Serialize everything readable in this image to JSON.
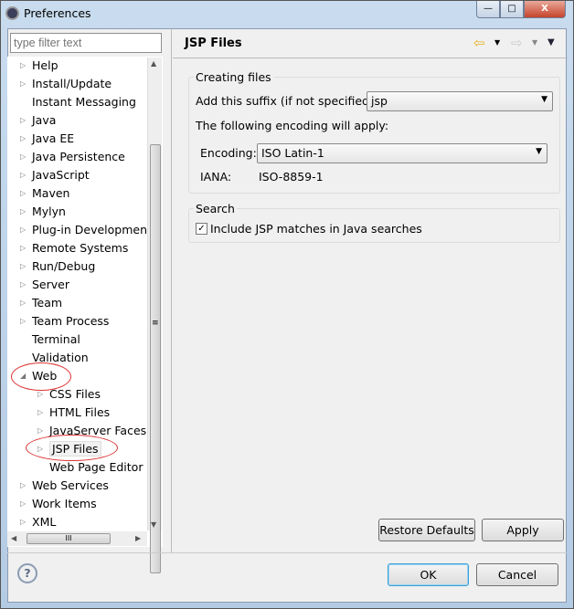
{
  "window": {
    "title": "Preferences",
    "minimize": "—",
    "maximize": "□",
    "close": "X"
  },
  "sidebar": {
    "filter_placeholder": "type filter text",
    "scroll_h_grip": "III",
    "scroll_v_grip": "≡",
    "items": [
      {
        "label": "Help",
        "expandable": true
      },
      {
        "label": "Install/Update",
        "expandable": true
      },
      {
        "label": "Instant Messaging",
        "expandable": false
      },
      {
        "label": "Java",
        "expandable": true
      },
      {
        "label": "Java EE",
        "expandable": true
      },
      {
        "label": "Java Persistence",
        "expandable": true
      },
      {
        "label": "JavaScript",
        "expandable": true
      },
      {
        "label": "Maven",
        "expandable": true
      },
      {
        "label": "Mylyn",
        "expandable": true
      },
      {
        "label": "Plug-in Development",
        "expandable": true
      },
      {
        "label": "Remote Systems",
        "expandable": true
      },
      {
        "label": "Run/Debug",
        "expandable": true
      },
      {
        "label": "Server",
        "expandable": true
      },
      {
        "label": "Team",
        "expandable": true
      },
      {
        "label": "Team Process",
        "expandable": true
      },
      {
        "label": "Terminal",
        "expandable": false
      },
      {
        "label": "Validation",
        "expandable": false
      },
      {
        "label": "Web",
        "expandable": true,
        "expanded": true
      },
      {
        "label": "CSS Files",
        "expandable": true,
        "child": true
      },
      {
        "label": "HTML Files",
        "expandable": true,
        "child": true
      },
      {
        "label": "JavaServer Faces T",
        "expandable": true,
        "child": true
      },
      {
        "label": "JSP Files",
        "expandable": true,
        "child": true,
        "selected": true
      },
      {
        "label": "Web Page Editor",
        "expandable": false,
        "child": true
      },
      {
        "label": "Web Services",
        "expandable": true
      },
      {
        "label": "Work Items",
        "expandable": true
      },
      {
        "label": "XML",
        "expandable": true
      }
    ]
  },
  "main": {
    "title": "JSP Files",
    "creating": {
      "label": "Creating files",
      "suffix_label": "Add this suffix (if not specified):",
      "suffix_value": "jsp",
      "encoding_note": "The following encoding will apply:",
      "encoding_label": "Encoding:",
      "encoding_value": "ISO Latin-1",
      "iana_label": "IANA:",
      "iana_value": "ISO-8859-1"
    },
    "search": {
      "label": "Search",
      "checkbox_label": "Include JSP matches in Java searches",
      "checked": true
    },
    "restore_defaults": "Restore Defaults",
    "apply": "Apply"
  },
  "footer": {
    "help": "?",
    "ok": "OK",
    "cancel": "Cancel"
  },
  "colors": {
    "annotation": "#dd3333",
    "back_arrow": "#e8b020"
  }
}
